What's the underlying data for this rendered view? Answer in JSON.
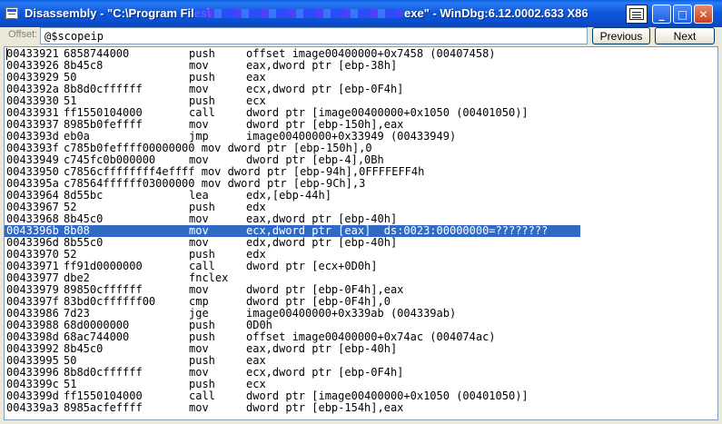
{
  "window": {
    "title_left": "Disassembly - \"C:\\Program Files\\",
    "title_right": "exe\" - WinDbg:6.12.0002.633 X86",
    "buttons": {
      "minimize": "_",
      "maximize": "□",
      "close": "✕"
    }
  },
  "toolbar": {
    "offset_label": "Offset:",
    "offset_value": "@$scopeip",
    "previous_label": "Previous",
    "next_label": "Next"
  },
  "disassembly": {
    "selected_index": 15,
    "lines": [
      {
        "addr": "00433921",
        "bytes": "6858744000",
        "mnem": "push",
        "ops": "offset image00400000+0x7458 (00407458)"
      },
      {
        "addr": "00433926",
        "bytes": "8b45c8",
        "mnem": "mov",
        "ops": "eax,dword ptr [ebp-38h]"
      },
      {
        "addr": "00433929",
        "bytes": "50",
        "mnem": "push",
        "ops": "eax"
      },
      {
        "addr": "0043392a",
        "bytes": "8b8d0cffffff",
        "mnem": "mov",
        "ops": "ecx,dword ptr [ebp-0F4h]"
      },
      {
        "addr": "00433930",
        "bytes": "51",
        "mnem": "push",
        "ops": "ecx"
      },
      {
        "addr": "00433931",
        "bytes": "ff1550104000",
        "mnem": "call",
        "ops": "dword ptr [image00400000+0x1050 (00401050)]"
      },
      {
        "addr": "00433937",
        "bytes": "8985b0feffff",
        "mnem": "mov",
        "ops": "dword ptr [ebp-150h],eax"
      },
      {
        "addr": "0043393d",
        "bytes": "eb0a",
        "mnem": "jmp",
        "ops": "image00400000+0x33949 (00433949)"
      },
      {
        "addr": "0043393f",
        "merged": "c785b0feffff00000000 mov dword ptr [ebp-150h],0"
      },
      {
        "addr": "00433949",
        "bytes": "c745fc0b000000",
        "mnem": "mov",
        "ops": "dword ptr [ebp-4],0Bh"
      },
      {
        "addr": "00433950",
        "merged": "c7856cffffffff4effff mov dword ptr [ebp-94h],0FFFFEFF4h"
      },
      {
        "addr": "0043395a",
        "merged": "c78564ffffff03000000 mov dword ptr [ebp-9Ch],3"
      },
      {
        "addr": "00433964",
        "bytes": "8d55bc",
        "mnem": "lea",
        "ops": "edx,[ebp-44h]"
      },
      {
        "addr": "00433967",
        "bytes": "52",
        "mnem": "push",
        "ops": "edx"
      },
      {
        "addr": "00433968",
        "bytes": "8b45c0",
        "mnem": "mov",
        "ops": "eax,dword ptr [ebp-40h]"
      },
      {
        "addr": "0043396b",
        "bytes": "8b08",
        "mnem": "mov",
        "ops": "ecx,dword ptr [eax]  ds:0023:00000000=????????"
      },
      {
        "addr": "0043396d",
        "bytes": "8b55c0",
        "mnem": "mov",
        "ops": "edx,dword ptr [ebp-40h]"
      },
      {
        "addr": "00433970",
        "bytes": "52",
        "mnem": "push",
        "ops": "edx"
      },
      {
        "addr": "00433971",
        "bytes": "ff91d0000000",
        "mnem": "call",
        "ops": "dword ptr [ecx+0D0h]"
      },
      {
        "addr": "00433977",
        "bytes": "dbe2",
        "mnem": "fnclex",
        "ops": ""
      },
      {
        "addr": "00433979",
        "bytes": "89850cffffff",
        "mnem": "mov",
        "ops": "dword ptr [ebp-0F4h],eax"
      },
      {
        "addr": "0043397f",
        "bytes": "83bd0cffffff00",
        "mnem": "cmp",
        "ops": "dword ptr [ebp-0F4h],0"
      },
      {
        "addr": "00433986",
        "bytes": "7d23",
        "mnem": "jge",
        "ops": "image00400000+0x339ab (004339ab)"
      },
      {
        "addr": "00433988",
        "bytes": "68d0000000",
        "mnem": "push",
        "ops": "0D0h"
      },
      {
        "addr": "0043398d",
        "bytes": "68ac744000",
        "mnem": "push",
        "ops": "offset image00400000+0x74ac (004074ac)"
      },
      {
        "addr": "00433992",
        "bytes": "8b45c0",
        "mnem": "mov",
        "ops": "eax,dword ptr [ebp-40h]"
      },
      {
        "addr": "00433995",
        "bytes": "50",
        "mnem": "push",
        "ops": "eax"
      },
      {
        "addr": "00433996",
        "bytes": "8b8d0cffffff",
        "mnem": "mov",
        "ops": "ecx,dword ptr [ebp-0F4h]"
      },
      {
        "addr": "0043399c",
        "bytes": "51",
        "mnem": "push",
        "ops": "ecx"
      },
      {
        "addr": "0043399d",
        "bytes": "ff1550104000",
        "mnem": "call",
        "ops": "dword ptr [image00400000+0x1050 (00401050)]"
      },
      {
        "addr": "004339a3",
        "bytes": "8985acfeffff",
        "mnem": "mov",
        "ops": "dword ptr [ebp-154h],eax"
      }
    ]
  }
}
